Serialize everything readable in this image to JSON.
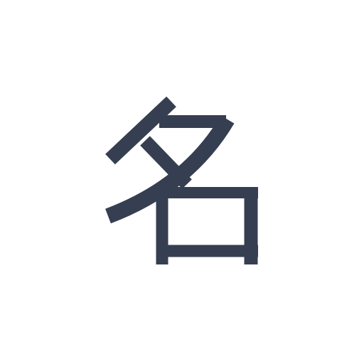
{
  "character": "名",
  "colors": {
    "background": "#ffffff",
    "glyph": "#363f51"
  }
}
